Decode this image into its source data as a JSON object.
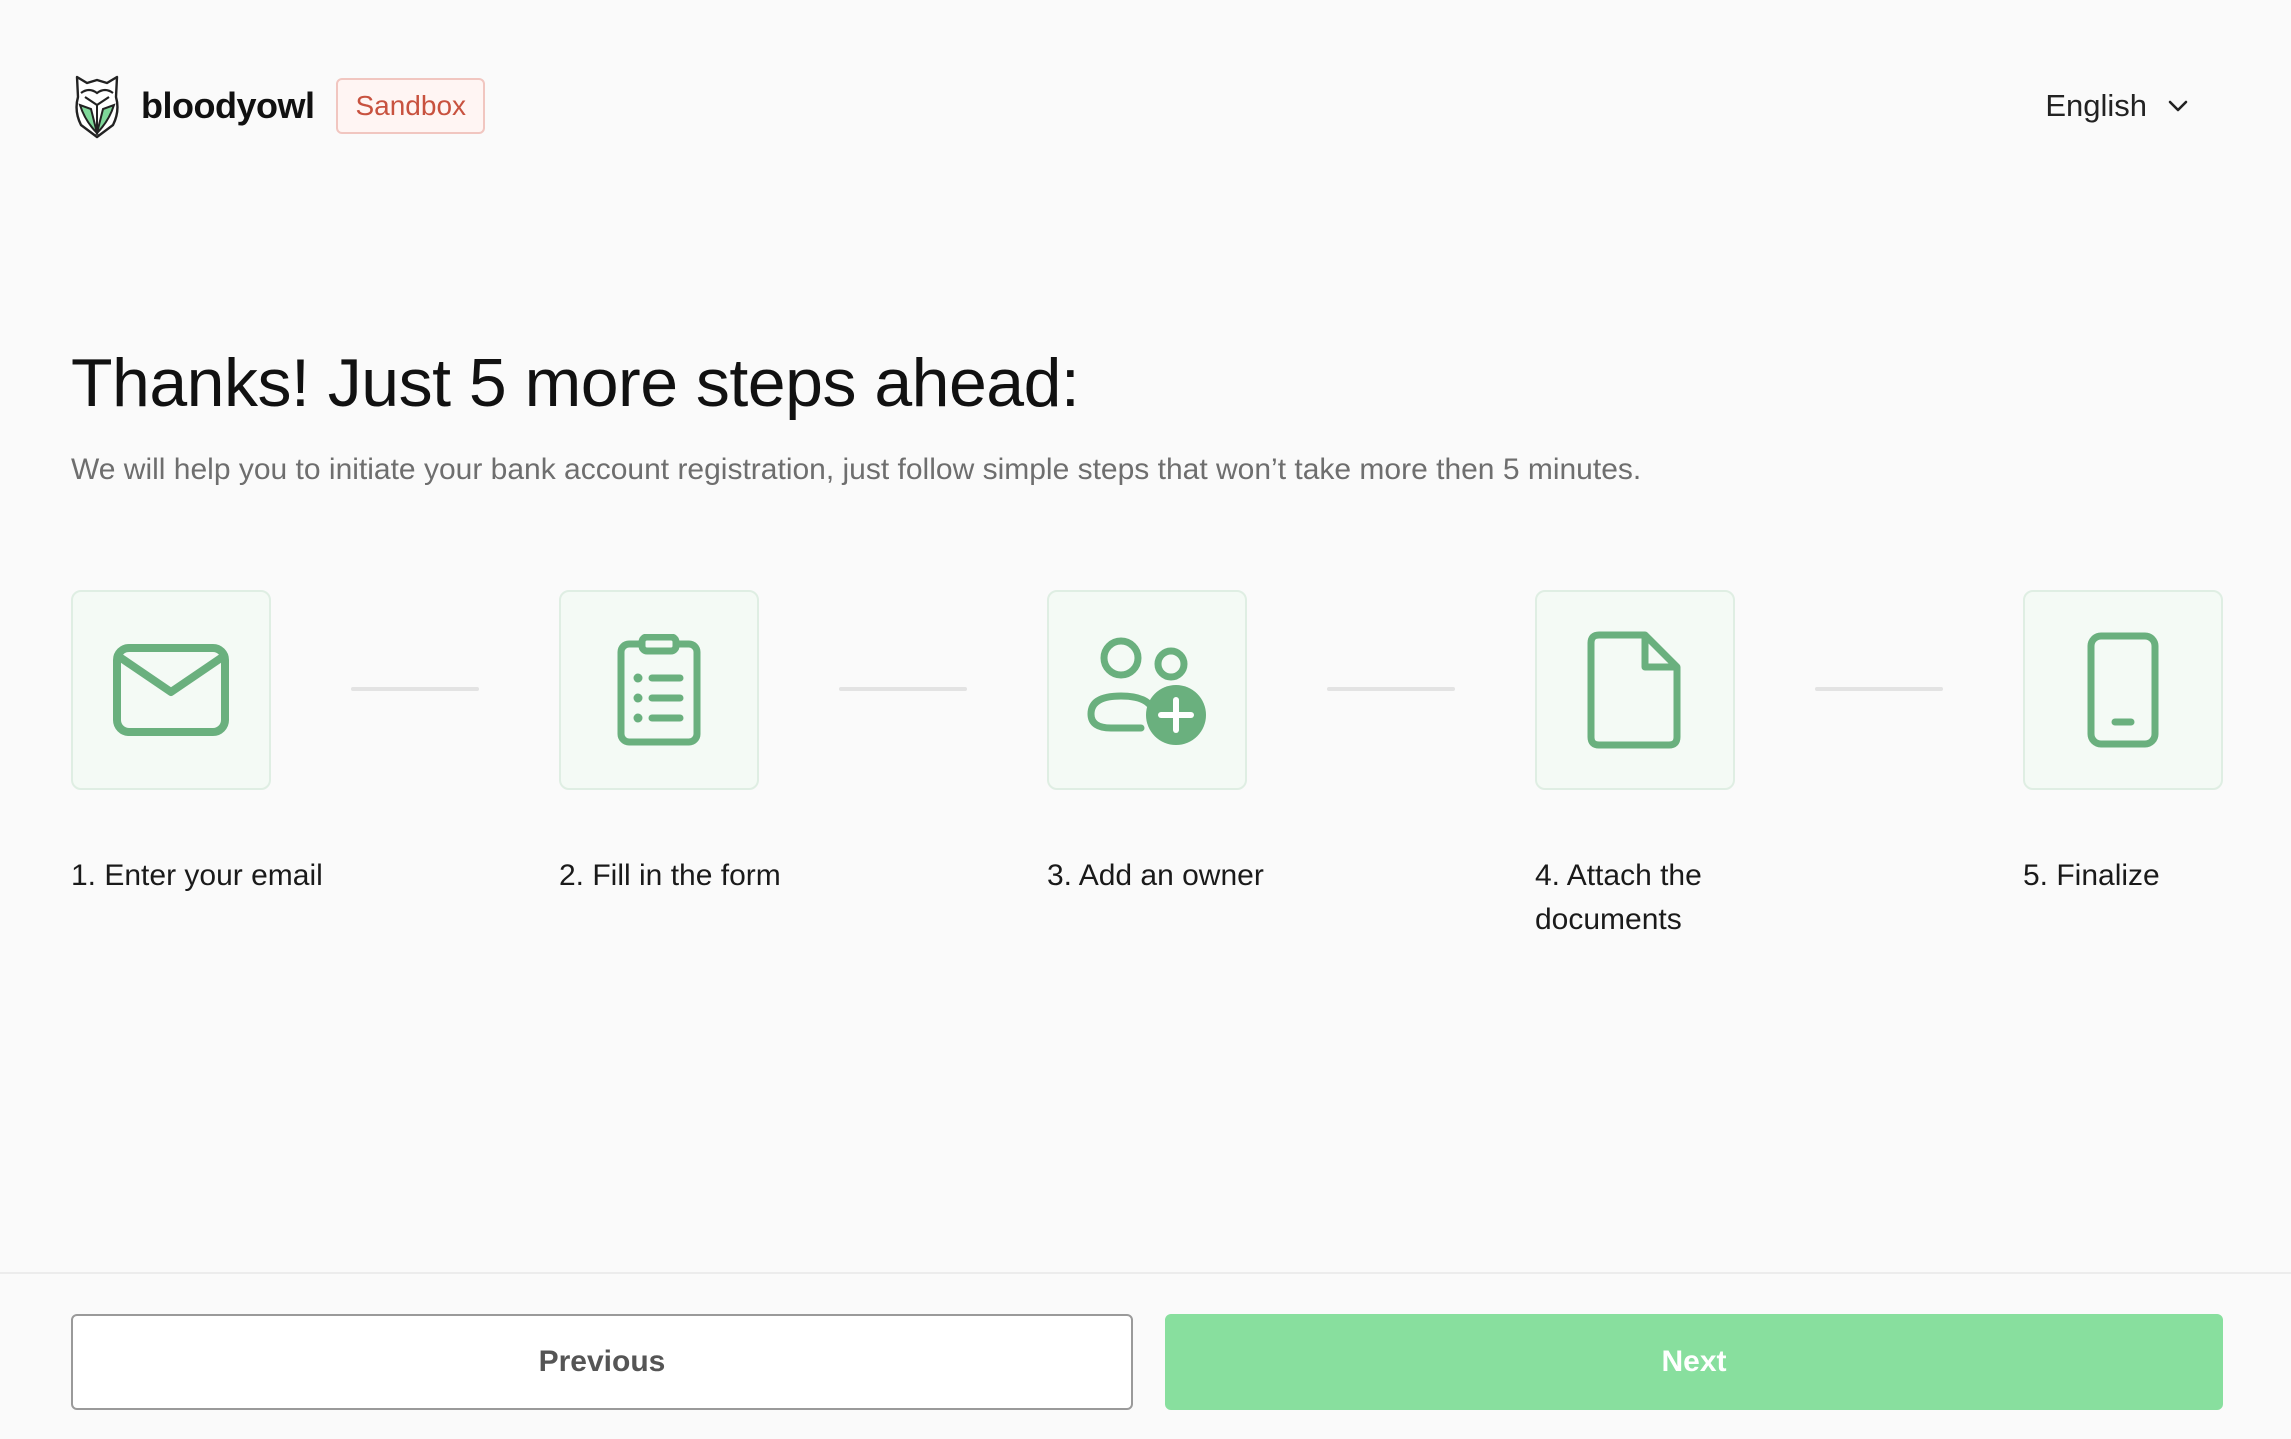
{
  "header": {
    "brand_name": "bloodyowl",
    "badge": "Sandbox",
    "language": "English"
  },
  "main": {
    "title": "Thanks! Just 5 more steps ahead:",
    "subtitle": "We will help you to initiate your bank account registration, just follow simple steps that won’t take more then 5 minutes."
  },
  "steps": [
    {
      "label": "1. Enter your email",
      "icon": "envelope-icon"
    },
    {
      "label": "2. Fill in the form",
      "icon": "clipboard-list-icon"
    },
    {
      "label": "3. Add an owner",
      "icon": "add-person-icon"
    },
    {
      "label": "4. Attach the documents",
      "icon": "document-icon"
    },
    {
      "label": "5. Finalize",
      "icon": "mobile-phone-icon"
    }
  ],
  "footer": {
    "previous_label": "Previous",
    "next_label": "Next"
  },
  "colors": {
    "accent": "#6ab07e",
    "next_button": "#88df9e",
    "sandbox": "#c8523f"
  }
}
